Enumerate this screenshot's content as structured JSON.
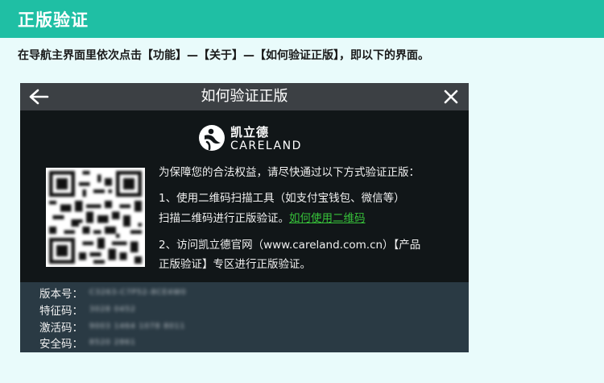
{
  "header": {
    "title": "正版验证"
  },
  "instruction": "在导航主界面里依次点击【功能】—【关于】—【如何验证正版】，即以下的界面。",
  "dialog": {
    "title": "如何验证正版",
    "logo": {
      "cn": "凯立德",
      "en": "CARELAND"
    },
    "intro": "为保障您的合法权益，请尽快通过以下方式验证正版：",
    "step1_line1": "1、使用二维码扫描工具（如支付宝钱包、微信等）",
    "step1_line2": "扫描二维码进行正版验证。",
    "step1_link": "如何使用二维码",
    "step2_line1": "2、访问凯立德官网（www.careland.com.cn）【产品",
    "step2_line2": "正版验证】专区进行正版验证。",
    "info": [
      {
        "label": "版本号：",
        "value": "C3263-C7P52-8CE4W0"
      },
      {
        "label": "特征码：",
        "value": "3028 0452"
      },
      {
        "label": "激活码：",
        "value": "9003 1464 1078 8011"
      },
      {
        "label": "安全码：",
        "value": "8520 2861"
      }
    ]
  },
  "colors": {
    "banner": "#1fbfa4",
    "link": "#37c23a",
    "dialog_bg": "#111618"
  }
}
